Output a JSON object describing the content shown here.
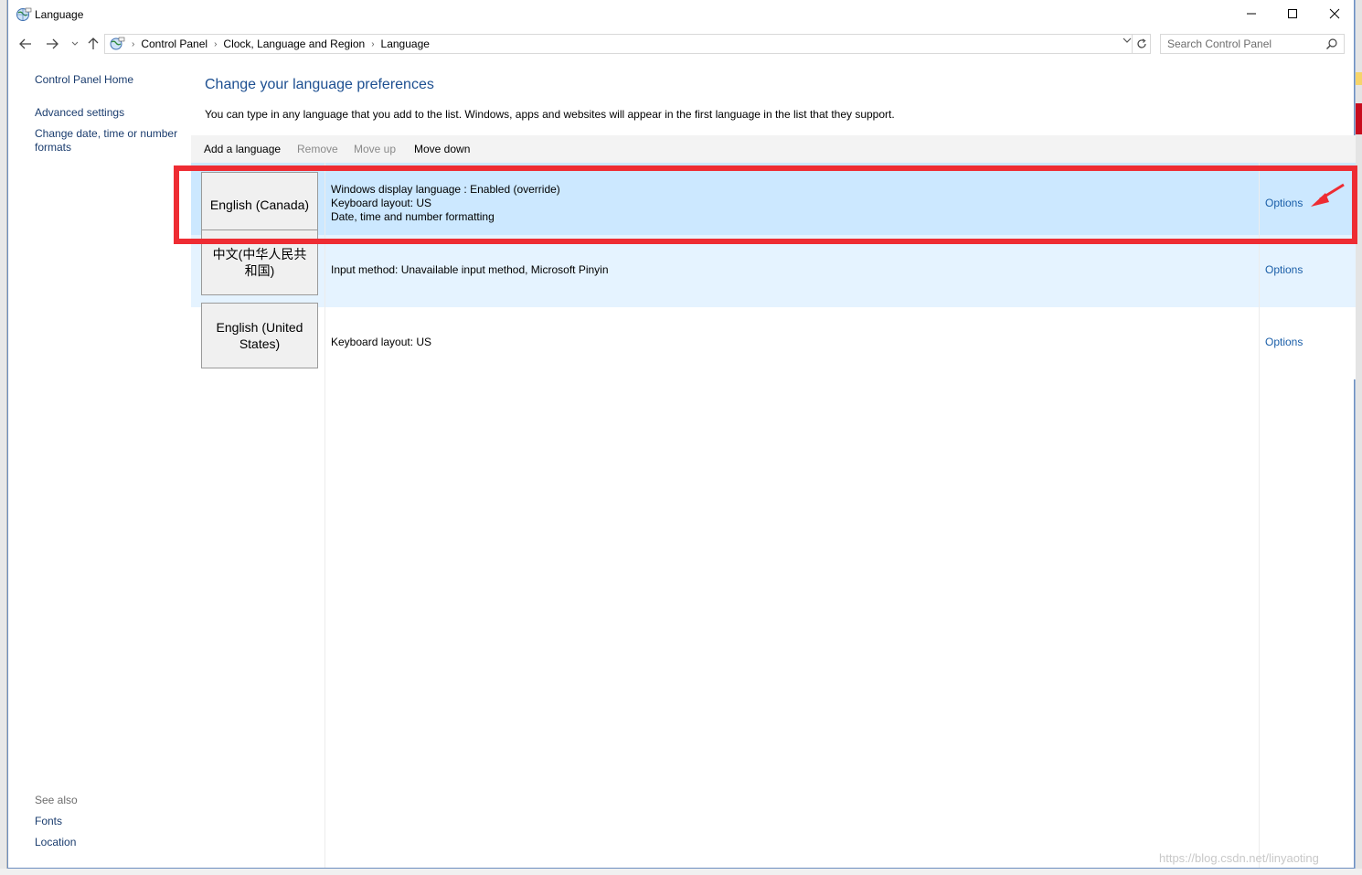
{
  "window": {
    "title": "Language",
    "minimize_symbol": "—",
    "maximize_symbol": "☐",
    "close_symbol": "✕"
  },
  "nav": {
    "back_icon": "arrow-left-icon",
    "forward_icon": "arrow-right-icon",
    "up_icon": "arrow-up-icon",
    "breadcrumbs": [
      "Control Panel",
      "Clock, Language and Region",
      "Language"
    ],
    "search_placeholder": "Search Control Panel"
  },
  "sidebar": {
    "links": [
      "Control Panel Home",
      "Advanced settings",
      "Change date, time or number formats"
    ],
    "see_also_label": "See also",
    "see_also_links": [
      "Fonts",
      "Location"
    ]
  },
  "main": {
    "heading": "Change your language preferences",
    "description": "You can type in any language that you add to the list. Windows, apps and websites will appear in the first language in the list that they support.",
    "toolbar": {
      "add": "Add a language",
      "remove": "Remove",
      "move_up": "Move up",
      "move_down": "Move down"
    },
    "languages": [
      {
        "name": "English (Canada)",
        "details": [
          "Windows display language : Enabled (override)",
          "Keyboard layout: US",
          "Date, time and number formatting"
        ],
        "options": "Options"
      },
      {
        "name": "中文(中华人民共和国)",
        "details": [
          "Input method: Unavailable input method, Microsoft Pinyin"
        ],
        "options": "Options"
      },
      {
        "name": "English (United States)",
        "details": [
          "Keyboard layout: US"
        ],
        "options": "Options"
      }
    ]
  },
  "annotation": {
    "highlight_color": "#ee2c33"
  },
  "watermark": "https://blog.csdn.net/linyaoting",
  "colors": {
    "selected_row": "#cce8ff",
    "hover_row": "#e5f3ff",
    "link": "#1a5ea8",
    "heading": "#1d4f91"
  }
}
